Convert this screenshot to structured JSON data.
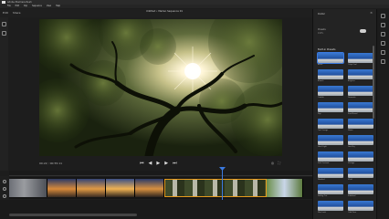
{
  "window": {
    "title": "Adobe Premiere Rush"
  },
  "menu": [
    "File",
    "Edit",
    "Clip",
    "Sequence",
    "View",
    "Help"
  ],
  "toolbar": {
    "left": [
      "Edit",
      "Share"
    ],
    "project_title": "Untitled • Marlen Sequence 01"
  },
  "transport": {
    "timecode_current": "00:22",
    "timecode_total": "00:55:11",
    "buttons": [
      "prev-marker",
      "step-back",
      "play",
      "step-forward",
      "next-marker"
    ]
  },
  "panel": {
    "title": "Color",
    "close": "×",
    "preset_label": "Presets",
    "intensity_label": "100%",
    "section": "Built-in Presets",
    "presets": [
      "Azure",
      "Crisp Cool",
      "Bleach",
      "Brighter",
      "Coolish",
      "Dramatic",
      "Pop",
      "Sun-Kissed",
      "Teal Orange",
      "Warm",
      "Hard Light",
      "Low Key",
      "Soft Contrast",
      "Vintage",
      "Washed",
      "Vivid",
      "Fading Out",
      "Subdued",
      "Film Look",
      "Cold Tone"
    ],
    "selected_preset": "Azure"
  },
  "colors": {
    "accent": "#3b7ae0",
    "selection": "#e59a1d",
    "background": "#1d1d1d"
  },
  "timeline": {
    "selected_clip": 3
  }
}
